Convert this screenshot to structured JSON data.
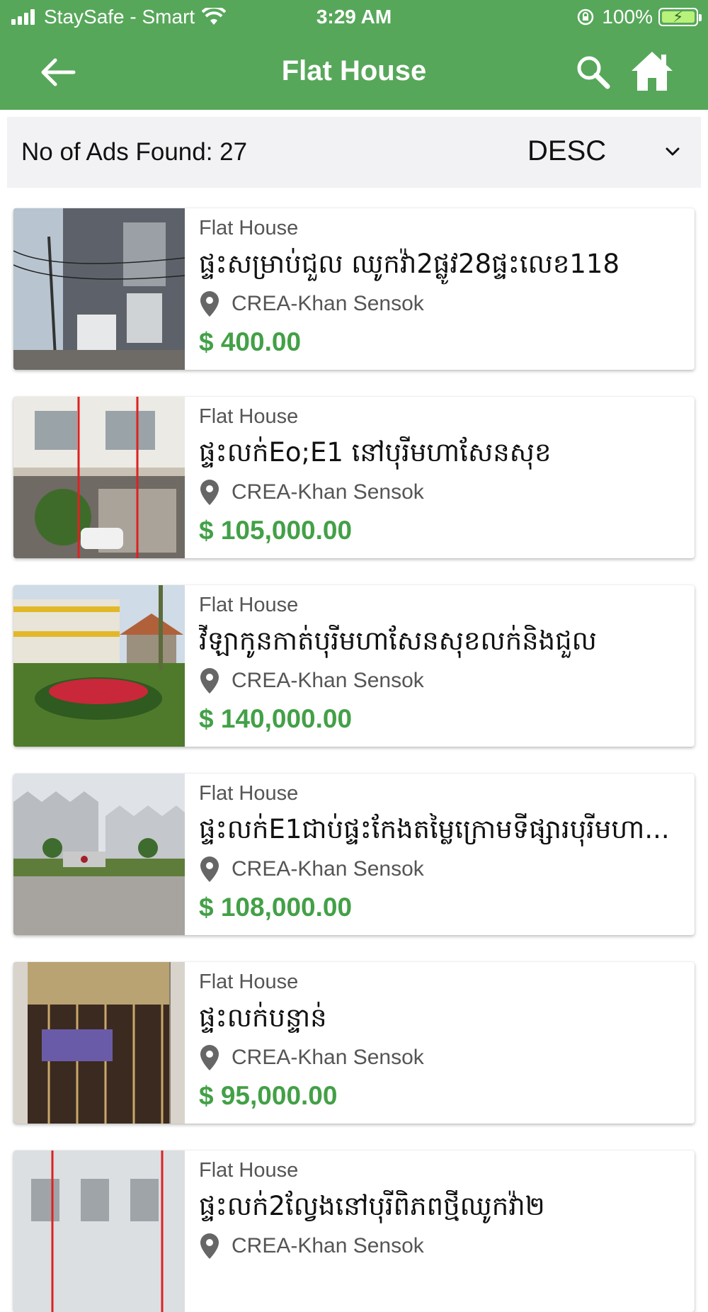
{
  "status_bar": {
    "carrier": "StaySafe - Smart",
    "time": "3:29 AM",
    "battery": "100%"
  },
  "nav": {
    "title": "Flat House",
    "back_icon": "arrow-left-icon",
    "search_icon": "search-icon",
    "home_icon": "home-icon"
  },
  "sort_bar": {
    "count_label": "No of Ads Found: 27",
    "order": "DESC"
  },
  "colors": {
    "header": "#57a75a",
    "price": "#43a047"
  },
  "listings": [
    {
      "category": "Flat House",
      "title": "ផ្ទះសម្រាប់ជួល ឈូកវ៉ា2ផ្លូវ28ផ្ទះលេខ118",
      "location": "CREA-Khan Sensok",
      "price": "$ 400.00"
    },
    {
      "category": "Flat House",
      "title": "ផ្ទះលក់Eo;E1 នៅបុរីមហាសែនសុខ",
      "location": "CREA-Khan Sensok",
      "price": "$ 105,000.00"
    },
    {
      "category": "Flat House",
      "title": "វីឡាកូនកាត់បុរីមហាសែនសុខលក់និងជួល",
      "location": "CREA-Khan Sensok",
      "price": "$ 140,000.00"
    },
    {
      "category": "Flat House",
      "title": "ផ្ទះលក់E1ជាប់ផ្ទះកែងតម្លៃក្រោមទីផ្សារបុរីមហា...",
      "location": "CREA-Khan Sensok",
      "price": "$ 108,000.00"
    },
    {
      "category": "Flat House",
      "title": "ផ្ទះលក់បន្ទាន់",
      "location": "CREA-Khan Sensok",
      "price": "$ 95,000.00"
    },
    {
      "category": "Flat House",
      "title": "ផ្ទះលក់2ល្វែងនៅបុរីពិភពថ្មីឈូកវ៉ា២",
      "location": "CREA-Khan Sensok",
      "price": ""
    }
  ]
}
